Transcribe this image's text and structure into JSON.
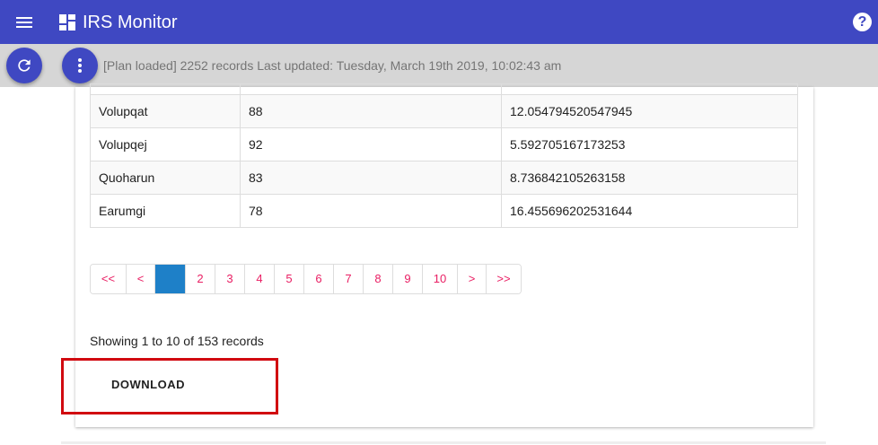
{
  "appbar": {
    "title": "IRS Monitor",
    "menu_icon": "hamburger-menu-icon",
    "logo_icon": "dashboard-icon",
    "help_icon": "help-icon",
    "help_label": "?",
    "color": "#3f48c2"
  },
  "statusbar": {
    "refresh_icon": "refresh-icon",
    "more_icon": "more-vert-icon",
    "text": "[Plan loaded] 2252 records Last updated: Tuesday, March 19th 2019, 10:02:43 am",
    "color": "#d6d6d6"
  },
  "table": {
    "rows": [
      [
        "Volupqat",
        "88",
        "12.054794520547945"
      ],
      [
        "Volupqej",
        "92",
        "5.592705167173253"
      ],
      [
        "Quoharun",
        "83",
        "8.736842105263158"
      ],
      [
        "Earumgi",
        "78",
        "16.455696202531644"
      ]
    ]
  },
  "pagination": {
    "first": "<<",
    "prev": "<",
    "pages": [
      "1",
      "2",
      "3",
      "4",
      "5",
      "6",
      "7",
      "8",
      "9",
      "10"
    ],
    "next": ">",
    "last": ">>",
    "active_page": "1",
    "link_color": "#e91e63",
    "active_color": "#1e80c8"
  },
  "footer": {
    "showing": "Showing 1 to 10 of 153 records",
    "download_label": "DOWNLOAD",
    "highlight_color": "#d10a10"
  }
}
